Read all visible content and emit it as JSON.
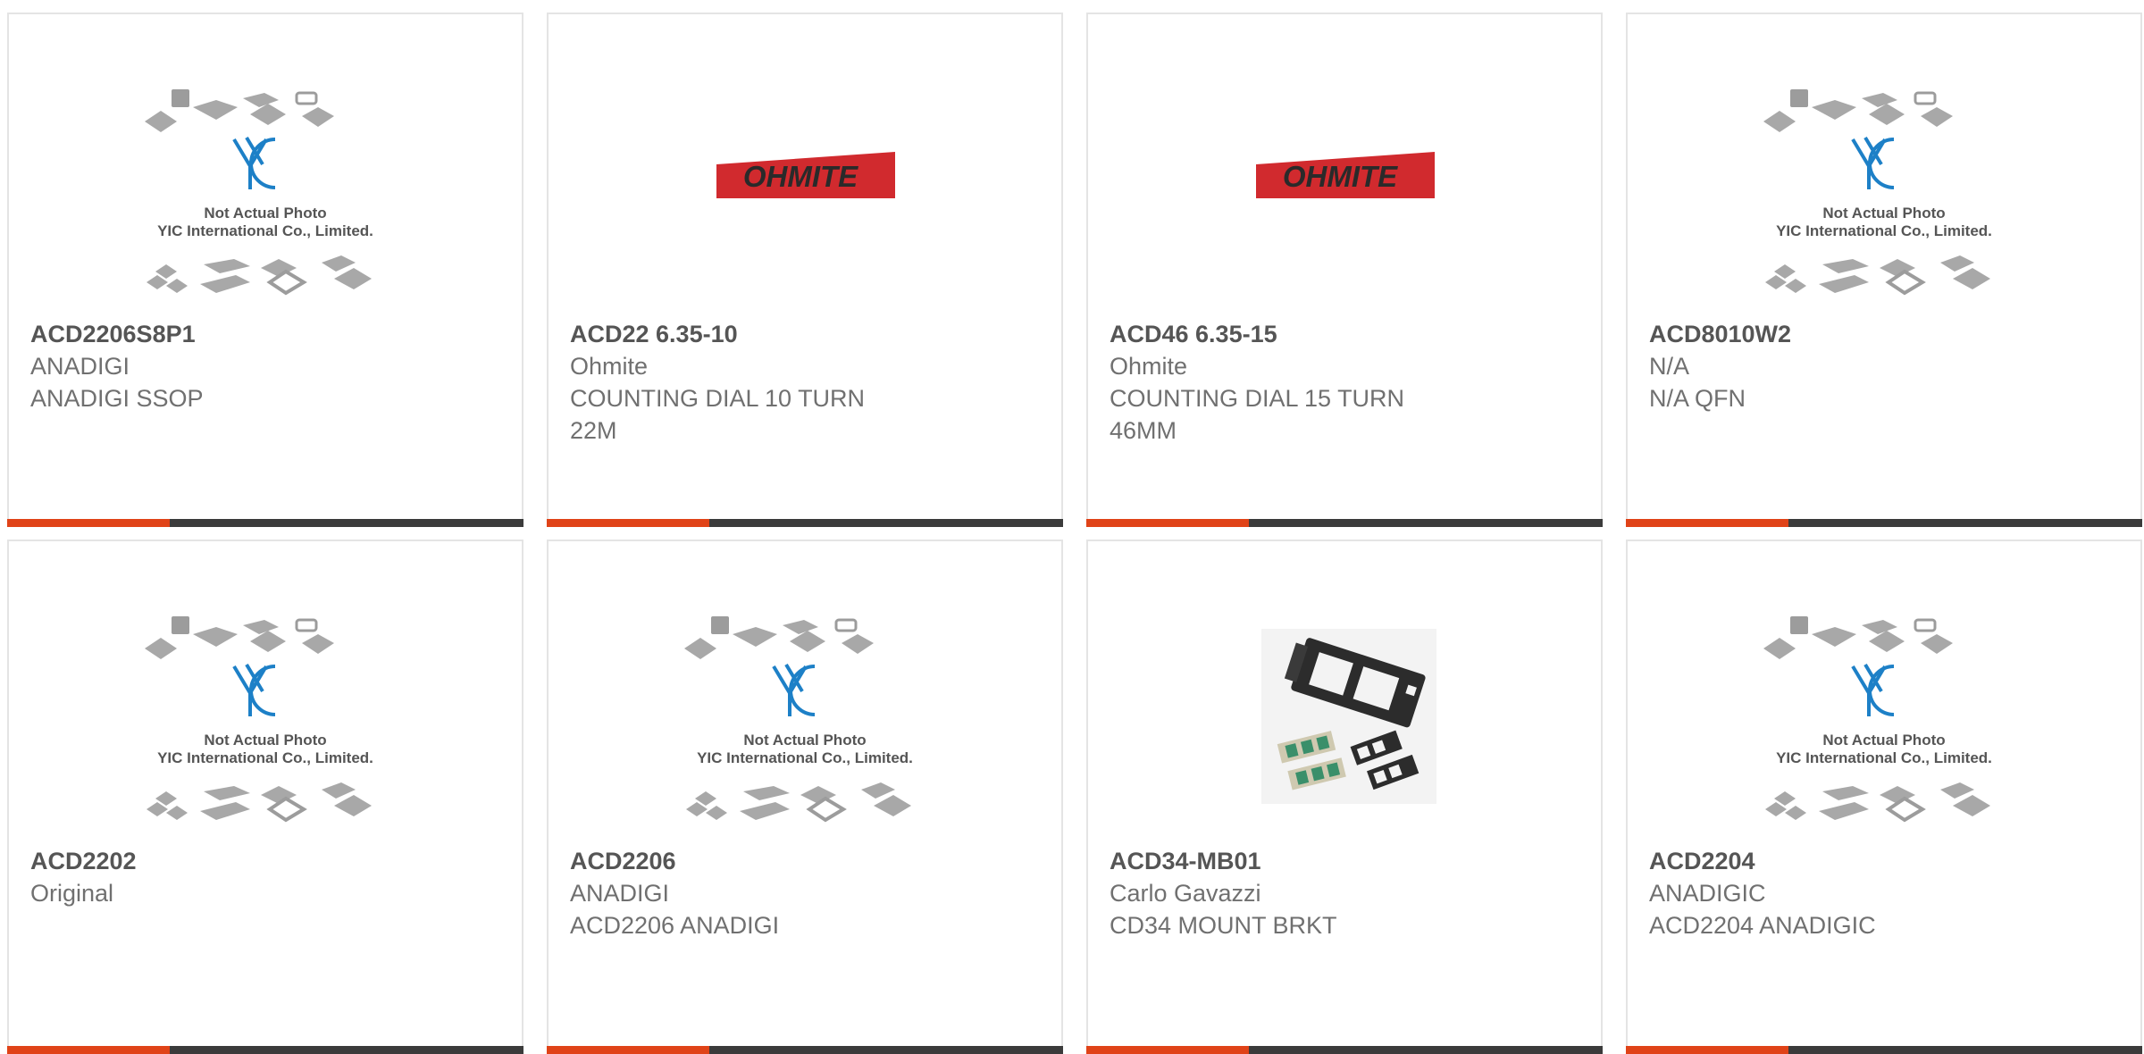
{
  "colors": {
    "accent": "#e04318",
    "bar_dark": "#3b3b3b",
    "border": "#e4e4e4",
    "ohmite_red": "#d12a2e",
    "yic_blue": "#1d80c7"
  },
  "placeholder_image": {
    "icon": "not-actual-photo-placeholder",
    "line1": "Not Actual Photo",
    "line2": "YIC International Co., Limited."
  },
  "products": [
    {
      "part_number": "ACD2206S8P1",
      "manufacturer": "ANADIGI",
      "description": "ANADIGI SSOP",
      "image": "yic-placeholder"
    },
    {
      "part_number": "ACD22 6.35-10",
      "manufacturer": "Ohmite",
      "description": "COUNTING DIAL 10 TURN 22M",
      "image": "ohmite-logo",
      "logo_text": "OHMITE"
    },
    {
      "part_number": "ACD46 6.35-15",
      "manufacturer": "Ohmite",
      "description": "COUNTING DIAL 15 TURN 46MM",
      "image": "ohmite-logo",
      "logo_text": "OHMITE"
    },
    {
      "part_number": "ACD8010W2",
      "manufacturer": "N/A",
      "description": "N/A QFN",
      "image": "yic-placeholder"
    },
    {
      "part_number": "ACD2202",
      "manufacturer": "Original",
      "description": "",
      "image": "yic-placeholder"
    },
    {
      "part_number": "ACD2206",
      "manufacturer": "ANADIGI",
      "description": "ACD2206 ANADIGI",
      "image": "yic-placeholder"
    },
    {
      "part_number": "ACD34-MB01",
      "manufacturer": "Carlo Gavazzi",
      "description": "CD34 MOUNT BRKT",
      "image": "mounting-bracket-photo"
    },
    {
      "part_number": "ACD2204",
      "manufacturer": "ANADIGIC",
      "description": "ACD2204 ANADIGIC",
      "image": "yic-placeholder"
    }
  ]
}
